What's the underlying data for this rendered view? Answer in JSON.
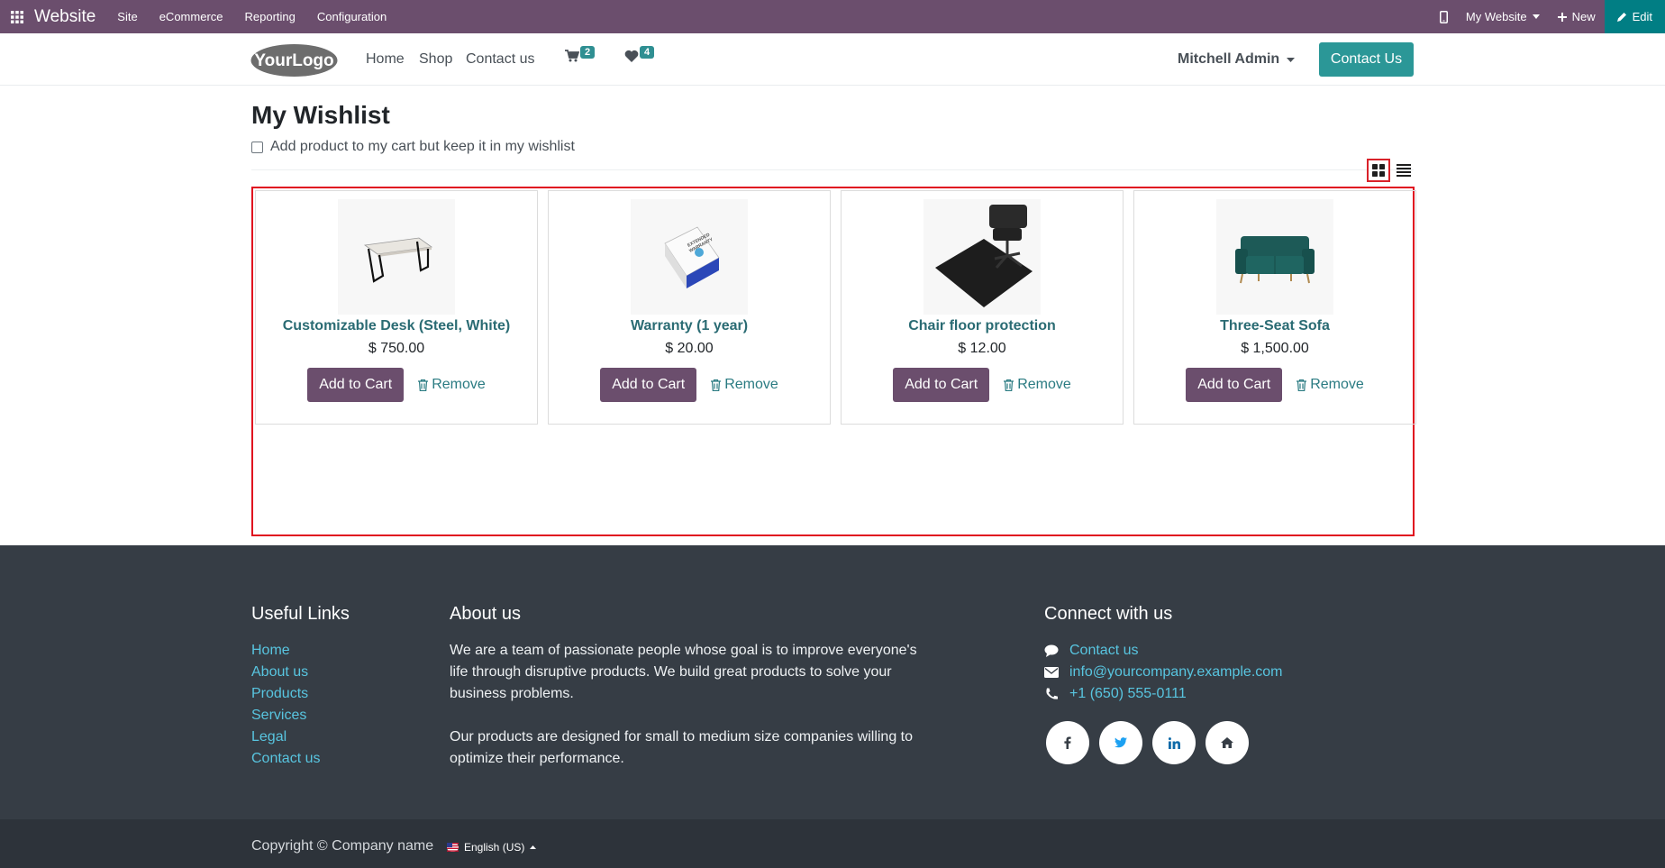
{
  "adminbar": {
    "brand": "Website",
    "menus": [
      "Site",
      "eCommerce",
      "Reporting",
      "Configuration"
    ],
    "website_selector": "My Website",
    "new_label": "New",
    "edit_label": "Edit"
  },
  "header": {
    "logo_text": "YourLogo",
    "nav": [
      "Home",
      "Shop",
      "Contact us"
    ],
    "cart_count": "2",
    "wishlist_count": "4",
    "user": "Mitchell Admin",
    "cta_label": "Contact Us"
  },
  "page": {
    "title": "My Wishlist",
    "keep_in_wishlist_label": "Add product to my cart but keep it in my wishlist",
    "keep_in_wishlist_checked": false,
    "view_mode": "grid"
  },
  "products": [
    {
      "name": "Customizable Desk (Steel, White)",
      "price": "$ 750.00",
      "add_label": "Add to Cart",
      "remove_label": "Remove",
      "icon": "desk-image"
    },
    {
      "name": "Warranty (1 year)",
      "price": "$ 20.00",
      "add_label": "Add to Cart",
      "remove_label": "Remove",
      "icon": "warranty-box-image"
    },
    {
      "name": "Chair floor protection",
      "price": "$ 12.00",
      "add_label": "Add to Cart",
      "remove_label": "Remove",
      "icon": "chair-mat-image"
    },
    {
      "name": "Three-Seat Sofa",
      "price": "$ 1,500.00",
      "add_label": "Add to Cart",
      "remove_label": "Remove",
      "icon": "sofa-image"
    }
  ],
  "footer": {
    "useful_links_title": "Useful Links",
    "useful_links": [
      "Home",
      "About us",
      "Products",
      "Services",
      "Legal",
      "Contact us"
    ],
    "about_title": "About us",
    "about_p1": "We are a team of passionate people whose goal is to improve everyone's life through disruptive products. We build great products to solve your business problems.",
    "about_p2": "Our products are designed for small to medium size companies willing to optimize their performance.",
    "connect_title": "Connect with us",
    "contact_label": "Contact us",
    "email": "info@yourcompany.example.com",
    "phone": "+1 (650) 555-0111",
    "social": [
      "facebook-icon",
      "twitter-icon",
      "linkedin-icon",
      "home-icon"
    ],
    "copyright": "Copyright © Company name",
    "language": "English (US)"
  },
  "colors": {
    "adminbar": "#6b4e6d",
    "accent_teal": "#2b9797",
    "edit_teal": "#017e84",
    "highlight_red": "#e00d1f",
    "footer_bg": "#363d45"
  }
}
